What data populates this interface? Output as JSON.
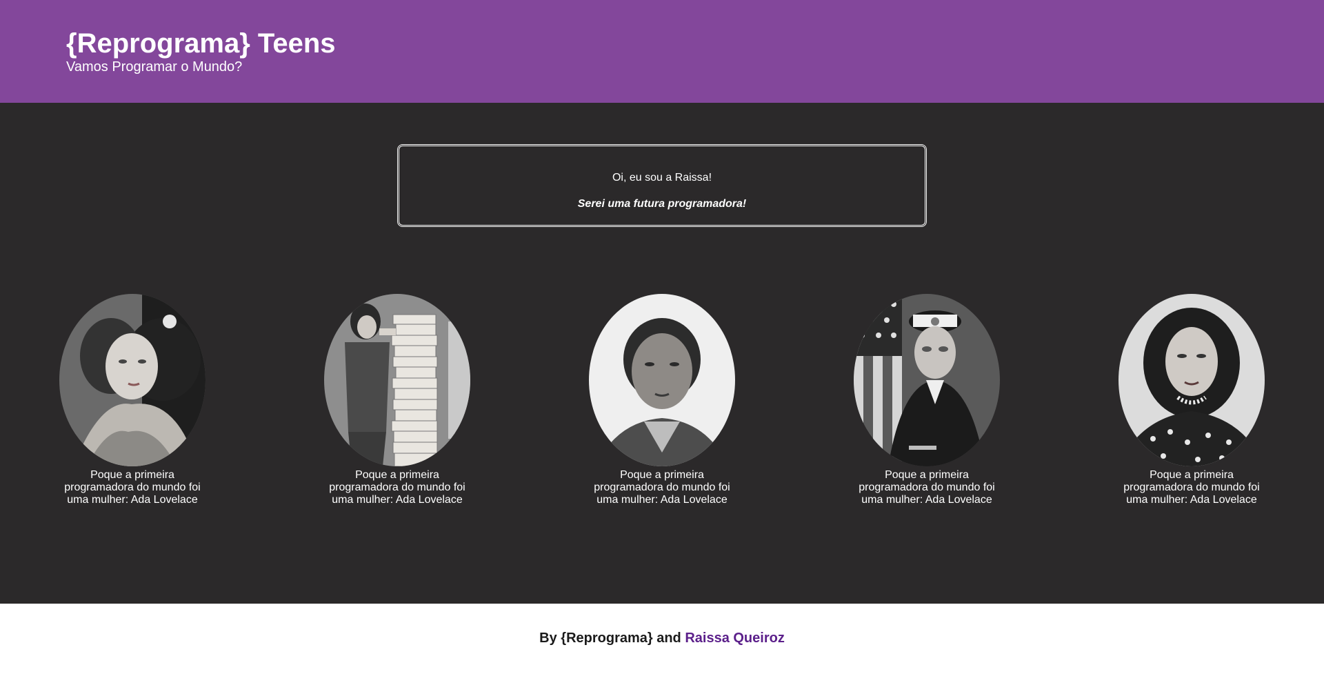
{
  "header": {
    "title": "{Reprograma} Teens",
    "subtitle": "Vamos Programar o Mundo?"
  },
  "intro": {
    "greeting": "Oi, eu sou a Raissa!",
    "goal": "Serei uma futura programadora!"
  },
  "gallery": {
    "cards": [
      {
        "caption": "Poque a primeira programadora do mundo foi uma mulher: Ada Lovelace",
        "portrait": "ada-lovelace-portrait"
      },
      {
        "caption": "Poque a primeira programadora do mundo foi uma mulher: Ada Lovelace",
        "portrait": "margaret-hamilton-portrait"
      },
      {
        "caption": "Poque a primeira programadora do mundo foi uma mulher: Ada Lovelace",
        "portrait": "dorothy-vaughan-portrait"
      },
      {
        "caption": "Poque a primeira programadora do mundo foi uma mulher: Ada Lovelace",
        "portrait": "grace-hopper-portrait"
      },
      {
        "caption": "Poque a primeira programadora do mundo foi uma mulher: Ada Lovelace",
        "portrait": "hedy-lamarr-portrait"
      }
    ]
  },
  "footer": {
    "prefix": "By {Reprograma} and ",
    "author_link": "Raissa Queiroz"
  },
  "colors": {
    "header_bg": "#83479b",
    "main_bg": "#2b292a",
    "footer_bg": "#ffffff",
    "link": "#5b1f8a"
  }
}
